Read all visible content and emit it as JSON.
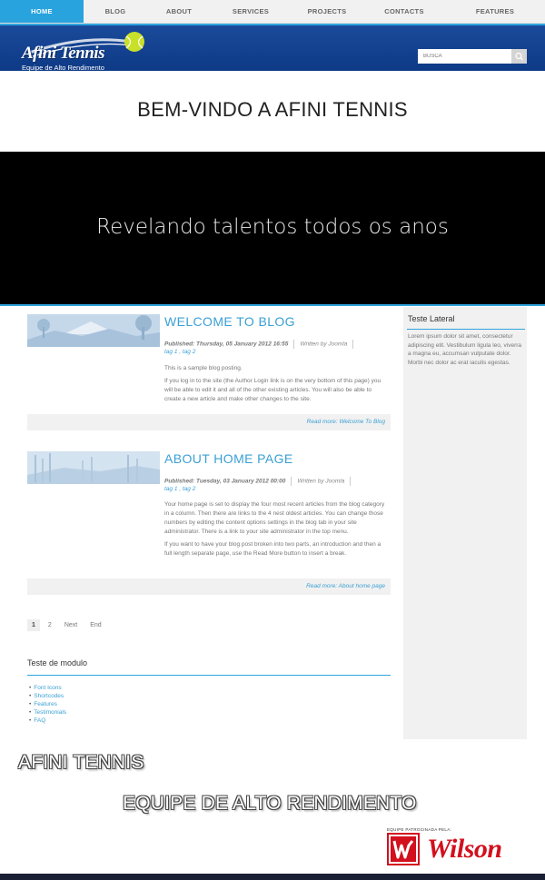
{
  "nav": {
    "items": [
      {
        "label": "HOME",
        "active": true
      },
      {
        "label": "BLOG"
      },
      {
        "label": "ABOUT"
      },
      {
        "label": "SERVICES"
      },
      {
        "label": "PROJECTS"
      },
      {
        "label": "CONTACTS"
      },
      {
        "label": "FEATURES"
      }
    ]
  },
  "header": {
    "logo_text": "Afini Tennis",
    "logo_sub": "Equipe de Alto Rendimento",
    "search_placeholder": "BUSCA"
  },
  "welcome_title": "BEM-VINDO A AFINI TENNIS",
  "hero_text": "Revelando talentos todos os anos",
  "articles": [
    {
      "title": "WELCOME TO BLOG",
      "published": "Published: Thursday, 05 January 2012 16:55",
      "written_by": "Written by Joomla",
      "tags": "tag 1 , tag 2",
      "paragraphs": [
        "This is a sample blog posting.",
        "If you log in to the site (the Author Login link is on the very bottom of this page) you will be able to edit it and all of the other existing articles. You will also be able to create a new article and make other changes to the site."
      ],
      "readmore": "Read more: Welcome To Blog"
    },
    {
      "title": "ABOUT HOME PAGE",
      "published": "Published: Tuesday, 03 January 2012 00:00",
      "written_by": "Written by Joomla",
      "tags": "tag 1 , tag 2",
      "paragraphs": [
        "Your home page is set to display the four most recent articles from the blog category in a column. Then there are links to the 4 nest oldest articles. You can change those numbers by editing the content options settings in the blog tab in your site administrator. There is a link to your site administrator in the top menu.",
        "If you want to have your blog post broken into two parts, an introduction and then a full length separate page, use the Read More button to insert a break."
      ],
      "readmore": "Read more: About home page"
    }
  ],
  "pagination": [
    "1",
    "2",
    "Next",
    "End"
  ],
  "module": {
    "title": "Teste de modulo",
    "links": [
      "Font Icons",
      "Shortcodes",
      "Features",
      "Testimonials",
      "FAQ"
    ]
  },
  "sidebar": {
    "title": "Teste Lateral",
    "text": "Lorem ipsum dolor sit amet, consectetur adipiscing elit. Vestibulum ligula leo, viverra a magna eu, accumsan vulputate dolor. Morbi nec dolor ac erat iaculis egestas."
  },
  "footer": {
    "title": "AFINI TENNIS",
    "subtitle": "EQUIPE DE ALTO RENDIMENTO",
    "sponsor_caption": "EQUIPE PATROCINADA PELA:",
    "sponsor_name": "Wilson"
  },
  "colors": {
    "accent": "#29a3dd",
    "header_blue": "#0e3a86",
    "link": "#3aa0d4",
    "wilson_red": "#d2101e"
  }
}
